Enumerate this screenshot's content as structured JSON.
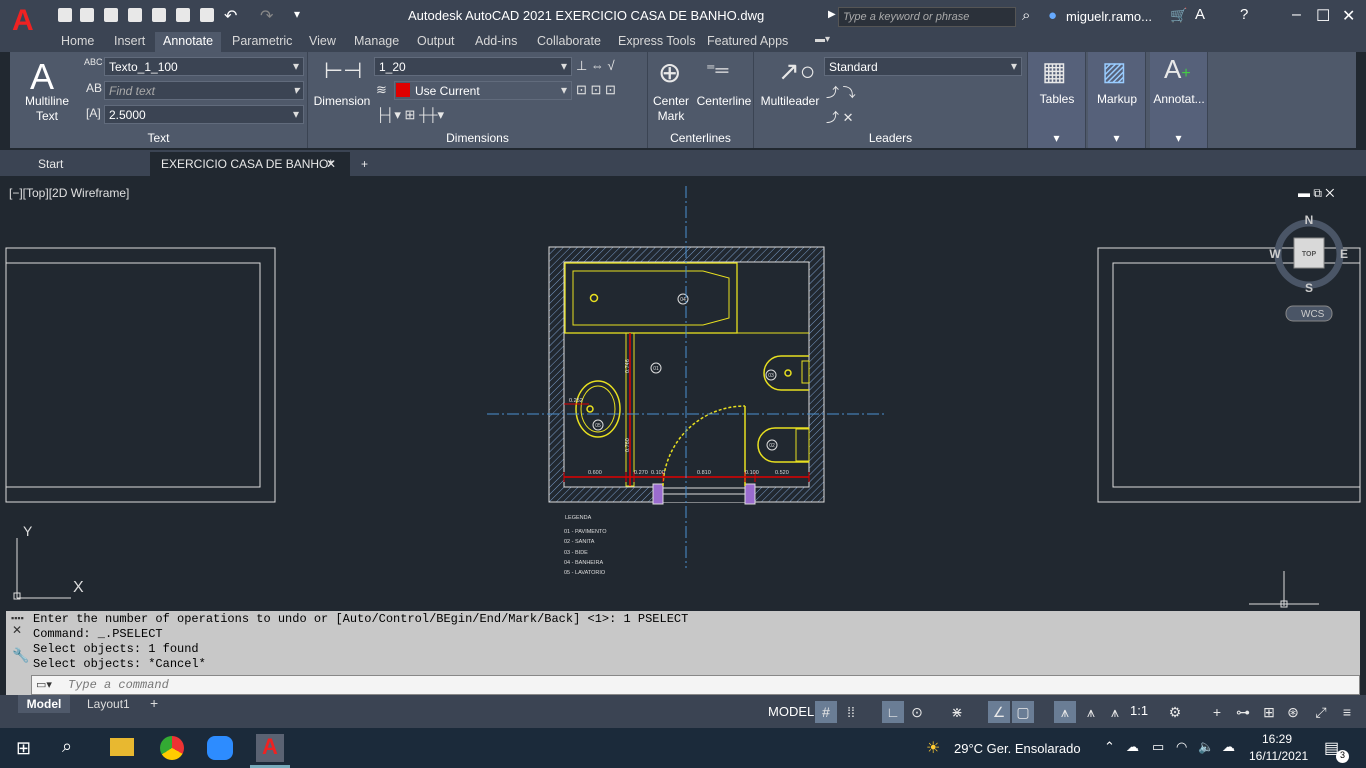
{
  "title": "Autodesk AutoCAD 2021    EXERCICIO CASA DE BANHO.dwg",
  "search_placeholder": "Type a keyword or phrase",
  "user": "miguelr.ramo...",
  "tabs": [
    "Home",
    "Insert",
    "Annotate",
    "Parametric",
    "View",
    "Manage",
    "Output",
    "Add-ins",
    "Collaborate",
    "Express Tools",
    "Featured Apps"
  ],
  "ribbon": {
    "text": {
      "big": "Multiline\nText",
      "style": "Texto_1_100",
      "find": "Find text",
      "height": "2.5000",
      "label": "Text"
    },
    "dimensions": {
      "big": "Dimension",
      "style": "1_20",
      "layer": "Use Current",
      "label": "Dimensions"
    },
    "centerlines": {
      "center_mark": "Center\nMark",
      "centerline": "Centerline",
      "label": "Centerlines"
    },
    "leaders": {
      "multileader": "Multileader",
      "style": "Standard",
      "label": "Leaders"
    },
    "tables": "Tables",
    "markup": "Markup",
    "annotate": "Annotat..."
  },
  "doc_tabs": {
    "start": "Start",
    "current": "EXERCICIO CASA DE BANHO*"
  },
  "viewport_label": "[−][Top][2D Wireframe]",
  "viewcube": {
    "n": "N",
    "s": "S",
    "e": "E",
    "w": "W",
    "top": "TOP",
    "wcs": "WCS"
  },
  "drawing": {
    "legend_title": "LEGENDA",
    "legend": [
      "01 - PAVIMENTO",
      "02 - SANITA",
      "03 - BIDE",
      "04 - BANHEIRA",
      "05 - LAVATORIO"
    ],
    "dims": [
      "0.600",
      "0.270",
      "0.100",
      "0.810",
      "0.100",
      "0.520"
    ],
    "dim_left": "0.252",
    "dim_v1": "0.746",
    "dim_v2": "0.760",
    "tags": [
      "04",
      "01",
      "03",
      "05",
      "02"
    ]
  },
  "ucs": {
    "x": "X",
    "y": "Y"
  },
  "command_history": [
    "Enter the number of operations to undo or [Auto/Control/BEgin/End/Mark/Back] <1>: 1 PSELECT",
    "Command: _.PSELECT",
    "Select objects: 1 found",
    "Select objects: *Cancel*"
  ],
  "command_placeholder": "Type a command",
  "layout_tabs": [
    "Model",
    "Layout1"
  ],
  "status": {
    "model": "MODEL",
    "scale": "1:1"
  },
  "taskbar": {
    "weather": "29°C  Ger. Ensolarado",
    "time": "16:29",
    "date": "16/11/2021",
    "notif": "3"
  }
}
